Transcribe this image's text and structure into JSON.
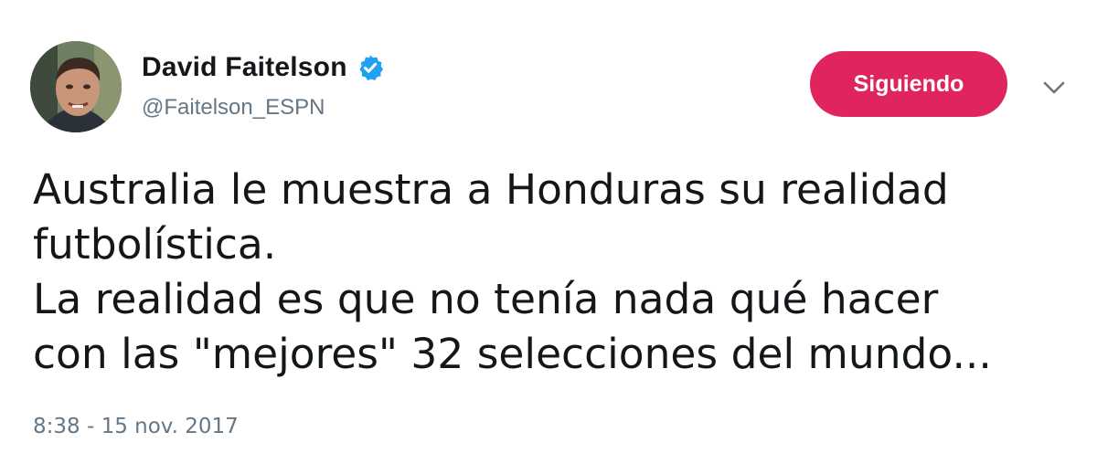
{
  "tweet": {
    "author": {
      "display_name": "David Faitelson",
      "handle": "@Faitelson_ESPN",
      "verified": true,
      "avatar_icon": "profile-photo"
    },
    "follow_button": {
      "label": "Siguiendo",
      "color": "#e0245e"
    },
    "menu_icon": "chevron-down-icon",
    "text_lines": [
      "Australia le muestra a Honduras su realidad",
      "futbolística.",
      "La realidad es que no tenía nada qué hacer",
      "con las \"mejores\" 32 selecciones del mundo..."
    ],
    "timestamp": "8:38 - 15 nov. 2017"
  },
  "colors": {
    "text_primary": "#14171a",
    "text_secondary": "#657786",
    "verified_blue": "#1da1f2"
  }
}
